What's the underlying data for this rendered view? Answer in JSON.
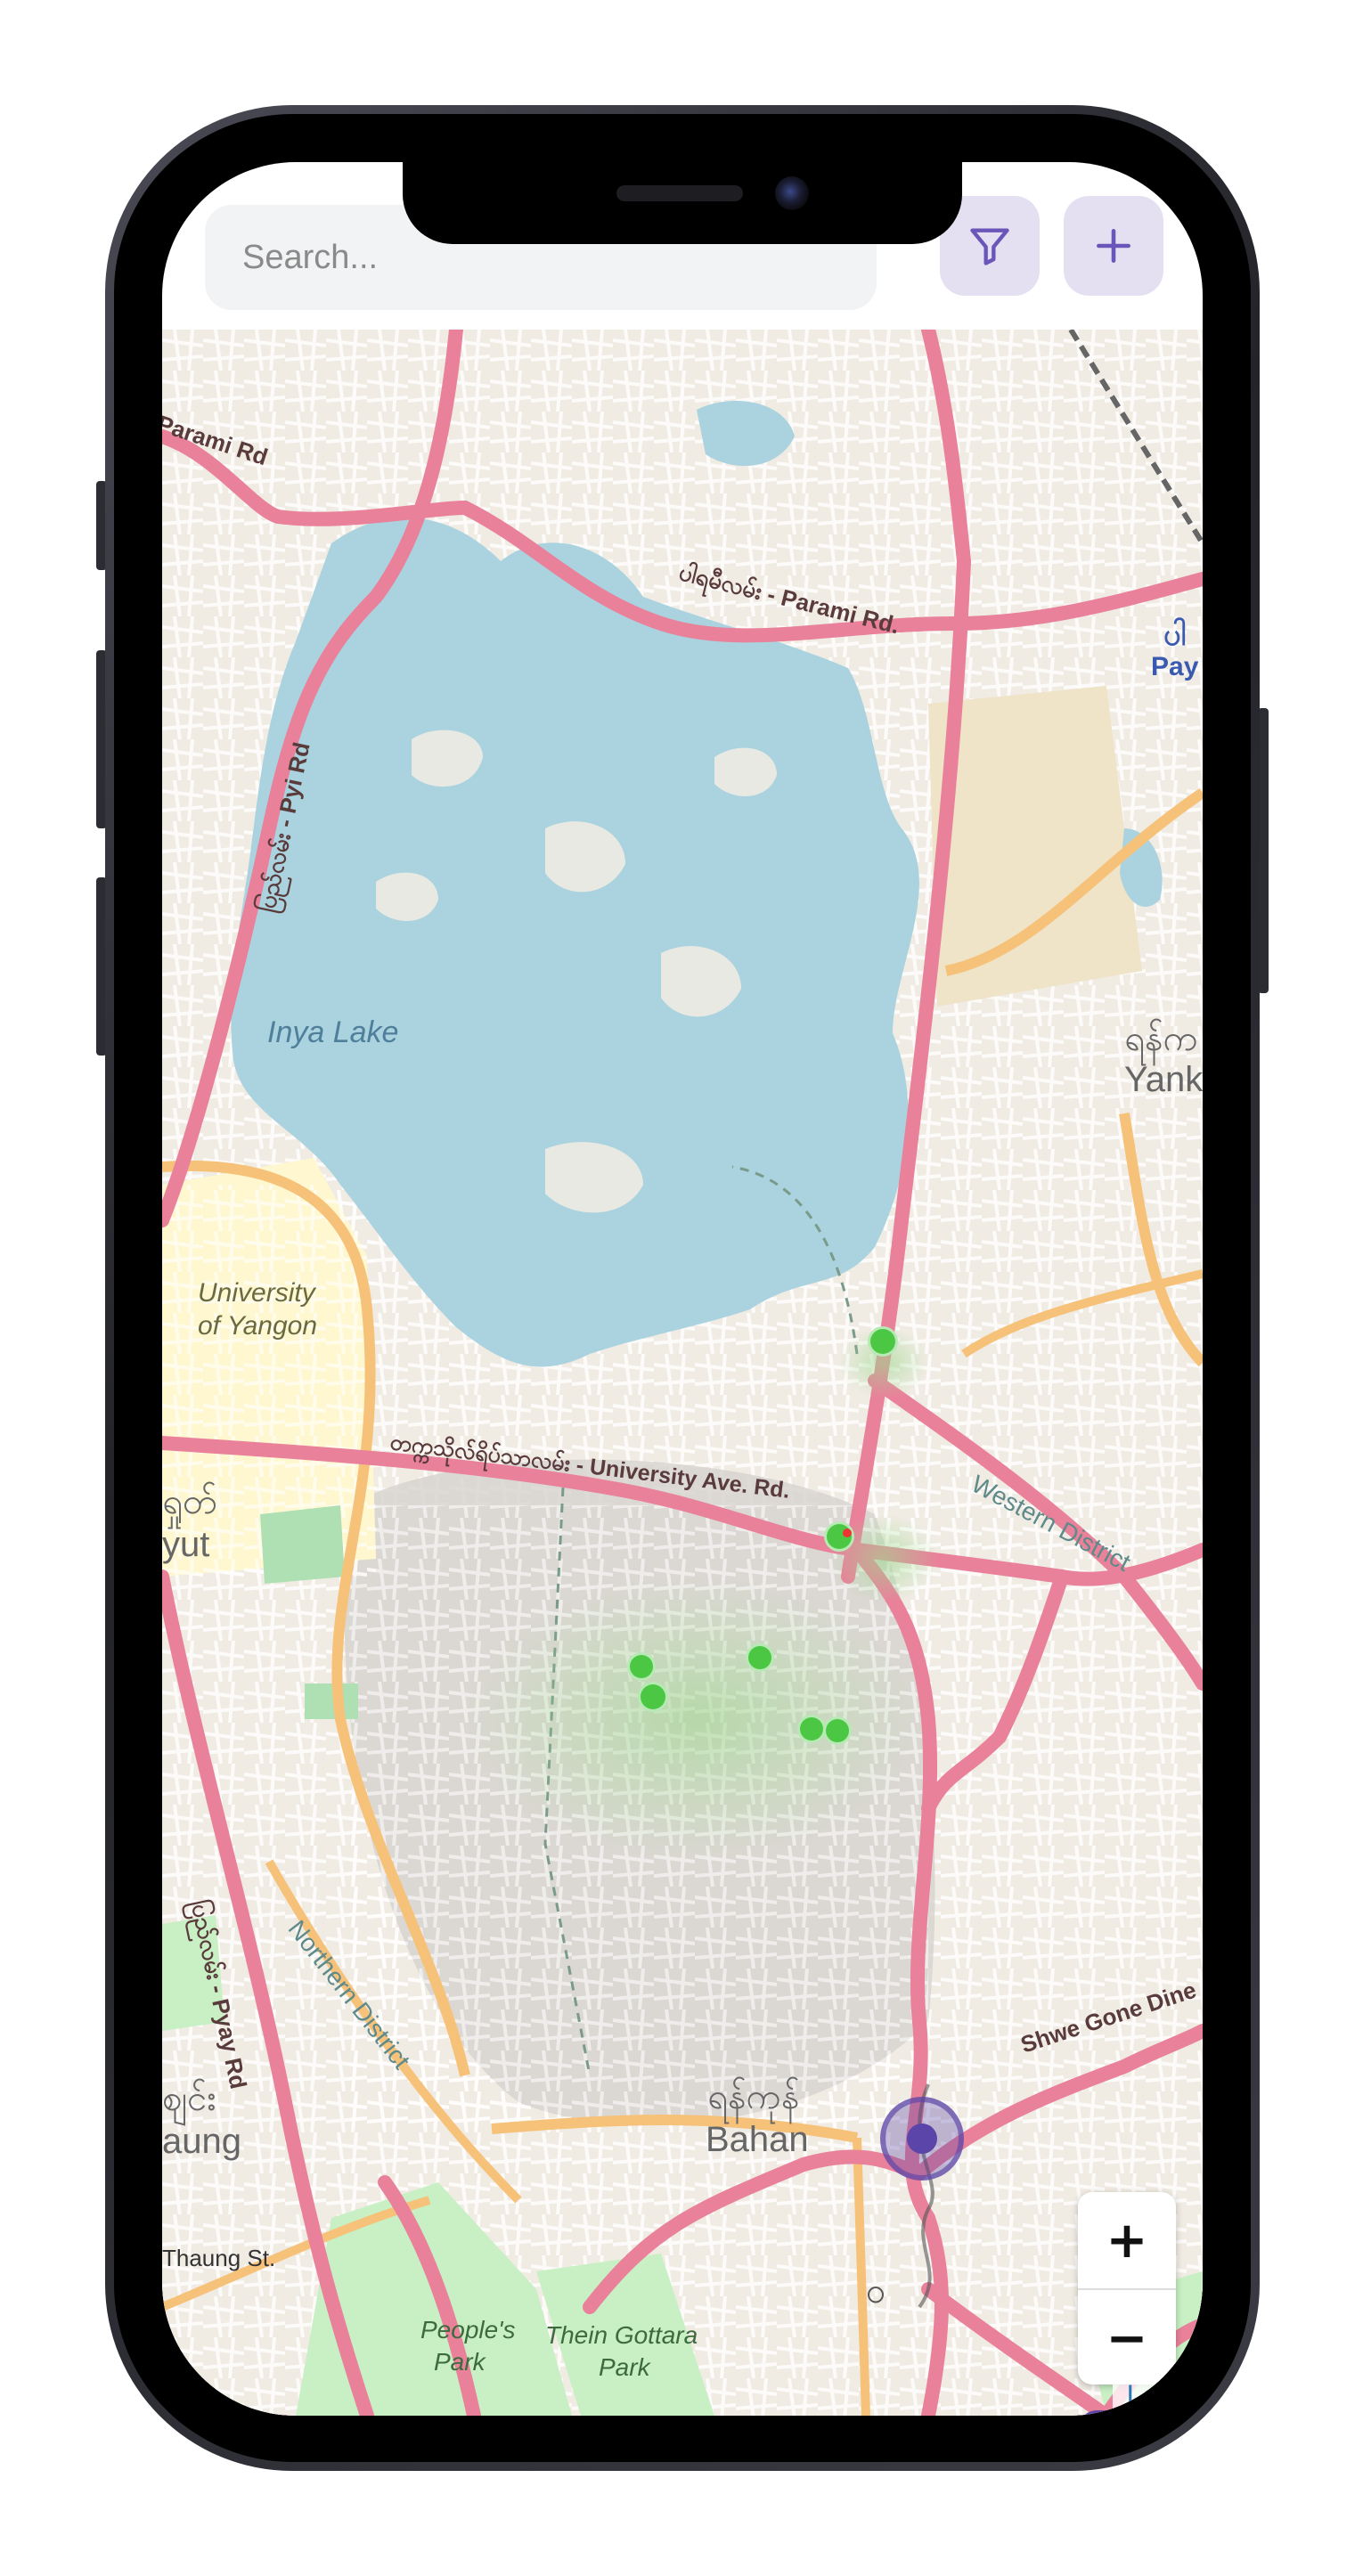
{
  "search": {
    "placeholder": "Search..."
  },
  "header": {
    "filter_icon": "filter-icon",
    "add_icon": "plus-icon"
  },
  "map": {
    "labels": {
      "parami_left": "Parami Rd",
      "parami_right": "ပါရမီလမ်း - Parami Rd.",
      "pyi_rd": "ပြည်လမ်း - Pyi Rd",
      "inya_lake": "Inya Lake",
      "university": "University",
      "of_yangon": "of Yangon",
      "university_ave": "တက္ကသိုလ်ရိပ်သာလမ်း - University Ave. Rd.",
      "western_district": "Western District",
      "kamayut_my": "ရှုတ်",
      "kamayut": "yut",
      "yankin_my": "ရန်က",
      "yankin": "Yank",
      "payu_my": "ပါ",
      "payu": "Pay",
      "northern_district": "Northern District",
      "pyay_rd": "ပြည်လမ်း - Pyay Rd",
      "sanchaung_my": "ဈင်း",
      "sanchaung": "aung",
      "thaung_st": "Thaung St.",
      "bahan_my": "ရန်ကုန်",
      "bahan": "Bahan",
      "shwe_gone_dine": "Shwe Gone Dine",
      "peoples_park_1": "People's",
      "peoples_park_2": "Park",
      "thein_gottara_1": "Thein Gottara",
      "thein_gottara_2": "Park",
      "ta_glyph": "ဝ"
    },
    "marker_color": "#4cc744",
    "location_color": "#5b45a8",
    "zoom_in": "+",
    "zoom_out": "−",
    "attribution": "Leafl"
  }
}
